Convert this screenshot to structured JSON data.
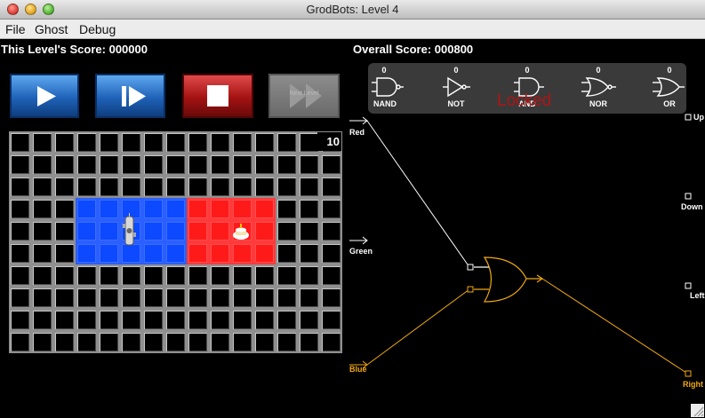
{
  "window": {
    "title": "GrodBots: Level 4"
  },
  "menu": {
    "items": [
      "File",
      "Ghost",
      "Debug"
    ]
  },
  "scores": {
    "level_label": "This Level's Score: 000000",
    "overall_label": "Overall Score: 000800"
  },
  "controls": {
    "next_label": "Next Level"
  },
  "board": {
    "counter": "10",
    "cols": 15,
    "rows": 10,
    "blue_color": "#0c49ff",
    "red_color": "#ff1a1a"
  },
  "palette": {
    "gates": [
      {
        "name": "NAND",
        "count": "0"
      },
      {
        "name": "NOT",
        "count": "0"
      },
      {
        "name": "AND",
        "count": "0"
      },
      {
        "name": "NOR",
        "count": "0"
      },
      {
        "name": "OR",
        "count": "0"
      }
    ],
    "locked_text": "Locked"
  },
  "inputs": {
    "red": "Red",
    "green": "Green",
    "blue": "Blue"
  },
  "outputs": {
    "up": "Up",
    "down": "Down",
    "left": "Left",
    "right": "Right"
  },
  "colors": {
    "wire_active": "#f0a810",
    "wire_idle": "#ffffff",
    "locked": "#b01414"
  }
}
